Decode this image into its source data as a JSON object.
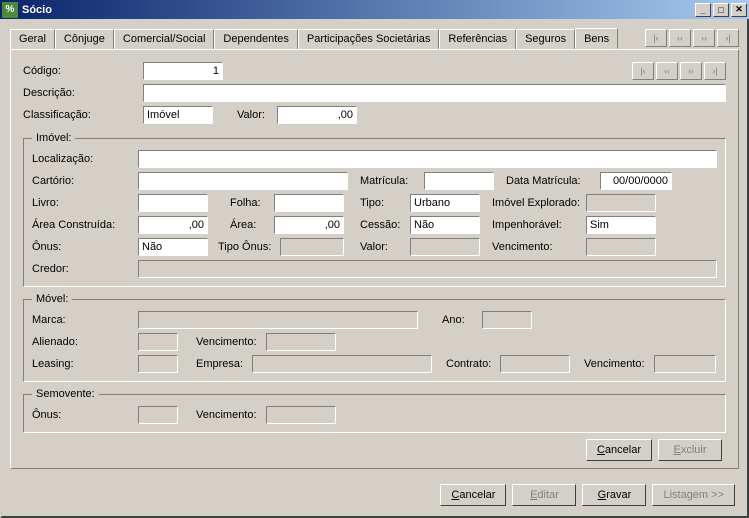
{
  "window": {
    "title": "Sócio"
  },
  "tabs": [
    "Geral",
    "Cônjuge",
    "Comercial/Social",
    "Dependentes",
    "Participações Societárias",
    "Referências",
    "Seguros",
    "Bens"
  ],
  "active_tab": 7,
  "nav": {
    "first": " |‹ ",
    "prev": "‹‹",
    "next": "››",
    "last": " ›| "
  },
  "form": {
    "codigo_label": "Código:",
    "codigo": "1",
    "descricao_label": "Descrição:",
    "descricao": "",
    "classificacao_label": "Classificação:",
    "classificacao": "Imóvel",
    "valor_label": "Valor:",
    "valor": ",00"
  },
  "imovel": {
    "legend": "Imóvel:",
    "localizacao_label": "Localização:",
    "localizacao": "",
    "cartorio_label": "Cartório:",
    "cartorio": "",
    "matricula_label": "Matrícula:",
    "matricula": "",
    "data_matricula_label": "Data Matrícula:",
    "data_matricula": "00/00/0000",
    "livro_label": "Livro:",
    "livro": "",
    "folha_label": "Folha:",
    "folha": "",
    "tipo_label": "Tipo:",
    "tipo": "Urbano",
    "imovel_explorado_label": "Imóvel Explorado:",
    "imovel_explorado": "",
    "area_construida_label": "Área Construída:",
    "area_construida": ",00",
    "area_label": "Área:",
    "area": ",00",
    "cessao_label": "Cessão:",
    "cessao": "Não",
    "impenhoravel_label": "Impenhorável:",
    "impenhoravel": "Sim",
    "onus_label": "Ônus:",
    "onus": "Não",
    "tipo_onus_label": "Tipo Ônus:",
    "tipo_onus": "",
    "valor_label": "Valor:",
    "valor": "",
    "vencimento_label": "Vencimento:",
    "vencimento": "",
    "credor_label": "Credor:",
    "credor": ""
  },
  "movel": {
    "legend": "Móvel:",
    "marca_label": "Marca:",
    "marca": "",
    "ano_label": "Ano:",
    "ano": "",
    "alienado_label": "Alienado:",
    "alienado": "",
    "vencimento1_label": "Vencimento:",
    "vencimento1": "",
    "leasing_label": "Leasing:",
    "leasing": "",
    "empresa_label": "Empresa:",
    "empresa": "",
    "contrato_label": "Contrato:",
    "contrato": "",
    "vencimento2_label": "Vencimento:",
    "vencimento2": ""
  },
  "semovente": {
    "legend": "Semovente:",
    "onus_label": "Ônus:",
    "onus": "",
    "vencimento_label": "Vencimento:",
    "vencimento": ""
  },
  "buttons": {
    "inner_cancelar": "Cancelar",
    "inner_excluir": "Excluir",
    "cancelar": "Cancelar",
    "editar": "Editar",
    "gravar": "Gravar",
    "listagem": "Listagem >>"
  }
}
